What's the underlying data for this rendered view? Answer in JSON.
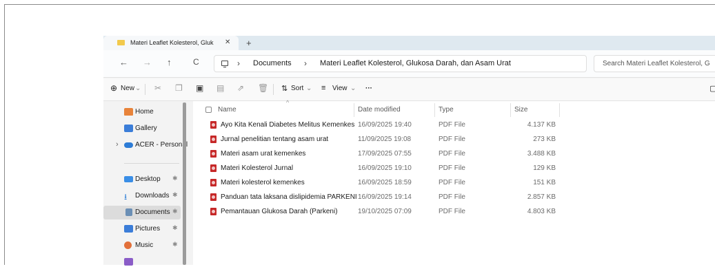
{
  "tab": {
    "title": "Materi Leaflet Kolesterol, Gluk",
    "close": "✕",
    "new": "+"
  },
  "nav": {
    "back": "←",
    "forward": "→",
    "up": "↑",
    "refresh": "C"
  },
  "breadcrumb": {
    "sep": "›",
    "items": [
      "Documents",
      "Materi Leaflet Kolesterol, Glukosa Darah, dan Asam Urat"
    ]
  },
  "search": {
    "placeholder": "Search Materi Leaflet Kolesterol, G"
  },
  "toolbar": {
    "new_label": "New",
    "sort_label": "Sort",
    "view_label": "View",
    "more": "···",
    "chevron": "⌄"
  },
  "sidebar": {
    "items": [
      {
        "label": "Home",
        "icon": "home-icon",
        "color": "#e8833a"
      },
      {
        "label": "Gallery",
        "icon": "gallery-icon",
        "color": "#3b7dd8"
      },
      {
        "label": "ACER - Personal",
        "icon": "cloud-icon",
        "color": "#2d7cd6"
      },
      {
        "label": "Desktop",
        "icon": "desktop-icon",
        "color": "#3a8ee6"
      },
      {
        "label": "Downloads",
        "icon": "download-icon",
        "color": "#2f7fd6"
      },
      {
        "label": "Documents",
        "icon": "documents-icon",
        "color": "#6b8fb5"
      },
      {
        "label": "Pictures",
        "icon": "pictures-icon",
        "color": "#3b7dd8"
      },
      {
        "label": "Music",
        "icon": "music-icon",
        "color": "#e2703a"
      }
    ],
    "expand_glyph": "›",
    "pin_glyph": "✱",
    "download_glyph": "⭳"
  },
  "table": {
    "columns": [
      "Name",
      "Date modified",
      "Type",
      "Size"
    ],
    "rows": [
      [
        "Ayo Kita Kenali Diabetes Melitus Kemenkes",
        "16/09/2025 19:40",
        "PDF File",
        "4.137 KB"
      ],
      [
        "Jurnal penelitian tentang asam urat",
        "11/09/2025 19:08",
        "PDF File",
        "273 KB"
      ],
      [
        "Materi asam urat kemenkes",
        "17/09/2025 07:55",
        "PDF File",
        "3.488 KB"
      ],
      [
        "Materi Kolesterol Jurnal",
        "16/09/2025 19:10",
        "PDF File",
        "129 KB"
      ],
      [
        "Materi kolesterol kemenkes",
        "16/09/2025 18:59",
        "PDF File",
        "151 KB"
      ],
      [
        "Panduan tata laksana dislipidemia PARKENI",
        "16/09/2025 19:14",
        "PDF File",
        "2.857 KB"
      ],
      [
        "Pemantauan Glukosa Darah (Parkeni)",
        "19/10/2025 07:09",
        "PDF File",
        "4.803 KB"
      ]
    ],
    "sort_glyph": "^"
  }
}
